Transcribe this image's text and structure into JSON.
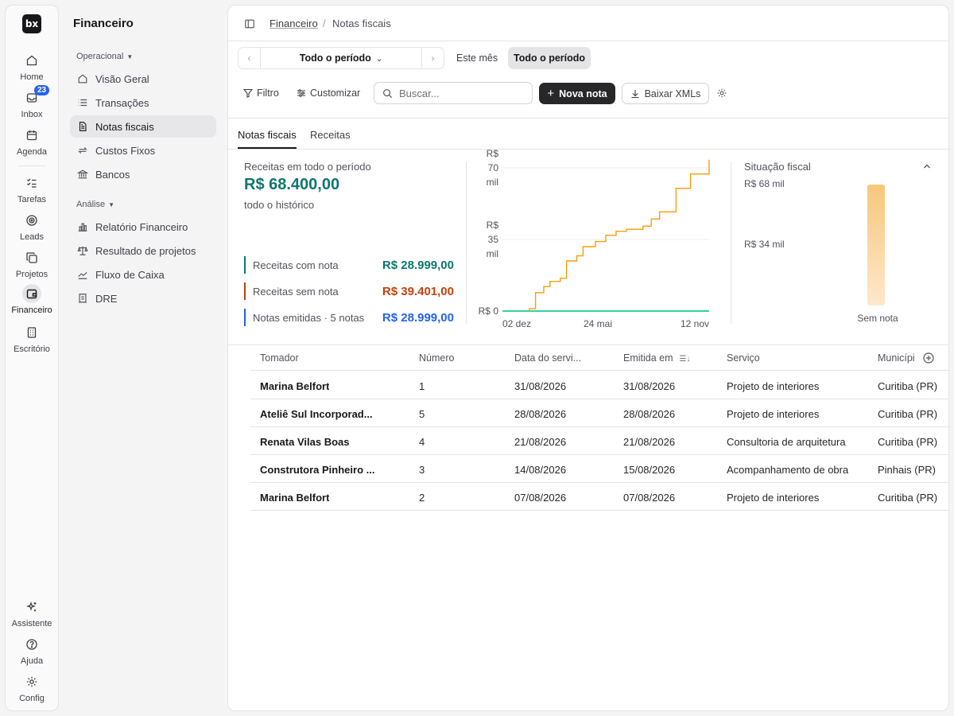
{
  "rail": {
    "logo": "bx",
    "home": "Home",
    "inbox": "Inbox",
    "inbox_badge": "23",
    "agenda": "Agenda",
    "tarefas": "Tarefas",
    "leads": "Leads",
    "projetos": "Projetos",
    "financeiro": "Financeiro",
    "escritorio": "Escritório",
    "assistente": "Assistente",
    "ajuda": "Ajuda",
    "config": "Config"
  },
  "sidebar": {
    "title": "Financeiro",
    "group_operacional": "Operacional",
    "group_analise": "Análise",
    "items_operacional": [
      "Visão Geral",
      "Transações",
      "Notas fiscais",
      "Custos Fixos",
      "Bancos"
    ],
    "items_analise": [
      "Relatório Financeiro",
      "Resultado de projetos",
      "Fluxo de Caixa",
      "DRE"
    ]
  },
  "breadcrumb": {
    "parent": "Financeiro",
    "separator": "/",
    "current": "Notas fiscais"
  },
  "toolbar": {
    "period_value": "Todo o período",
    "preset_month": "Este mês",
    "preset_all": "Todo o período",
    "filter": "Filtro",
    "customize": "Customizar",
    "search_placeholder": "Buscar...",
    "new_note": "Nova nota",
    "download_xml": "Baixar XMLs"
  },
  "tabs": [
    "Notas fiscais",
    "Receitas"
  ],
  "summary": {
    "label": "Receitas em todo o período",
    "total": "R$ 68.400,00",
    "sub": "todo o histórico",
    "stats": [
      {
        "label": "Receitas com nota",
        "value": "R$ 28.999,00",
        "color": "#0f766e"
      },
      {
        "label": "Receitas sem nota",
        "value": "R$ 39.401,00",
        "color": "#c2410c"
      },
      {
        "label": "Notas emitidas · 5 notas",
        "value": "R$ 28.999,00",
        "color": "#2563eb"
      }
    ]
  },
  "chart_data": {
    "type": "line",
    "y_ticks": [
      {
        "value": 70000,
        "lines": [
          "R$",
          "70",
          "mil"
        ]
      },
      {
        "value": 35000,
        "lines": [
          "R$",
          "35",
          "mil"
        ]
      },
      {
        "value": 0,
        "lines": [
          "R$ 0"
        ]
      }
    ],
    "ylim": [
      0,
      70000
    ],
    "x_ticks": [
      "02 dez",
      "24 mai",
      "12 nov"
    ],
    "series": [
      {
        "color": "#f59e0b",
        "x": [
          0,
          0.13,
          0.16,
          0.2,
          0.23,
          0.28,
          0.31,
          0.36,
          0.39,
          0.45,
          0.5,
          0.55,
          0.6,
          0.68,
          0.72,
          0.76,
          0.84,
          0.91,
          1.0
        ],
        "values": [
          0,
          1200,
          9000,
          12000,
          14500,
          16000,
          24500,
          27000,
          31500,
          34000,
          37000,
          39000,
          40000,
          41500,
          45000,
          48500,
          60000,
          67000,
          74000
        ]
      },
      {
        "color": "#34d399",
        "x": [
          0,
          1.0
        ],
        "values": [
          0,
          0
        ]
      }
    ]
  },
  "fiscal": {
    "title": "Situação fiscal",
    "y_top": "R$ 68 mil",
    "y_mid": "R$ 34 mil",
    "category": "Sem nota",
    "value": 68000
  },
  "table": {
    "headers": [
      "Tomador",
      "Número",
      "Data do servi...",
      "Emitida em",
      "Serviço",
      "Municípi"
    ],
    "rows": [
      [
        "Marina Belfort",
        "1",
        "31/08/2026",
        "31/08/2026",
        "Projeto de interiores",
        "Curitiba (PR)"
      ],
      [
        "Ateliê Sul Incorporad...",
        "5",
        "28/08/2026",
        "28/08/2026",
        "Projeto de interiores",
        "Curitiba (PR)"
      ],
      [
        "Renata Vilas Boas",
        "4",
        "21/08/2026",
        "21/08/2026",
        "Consultoria de arquitetura",
        "Curitiba (PR)"
      ],
      [
        "Construtora Pinheiro ...",
        "3",
        "14/08/2026",
        "15/08/2026",
        "Acompanhamento de obra",
        "Pinhais (PR)"
      ],
      [
        "Marina Belfort",
        "2",
        "07/08/2026",
        "07/08/2026",
        "Projeto de interiores",
        "Curitiba (PR)"
      ]
    ]
  }
}
